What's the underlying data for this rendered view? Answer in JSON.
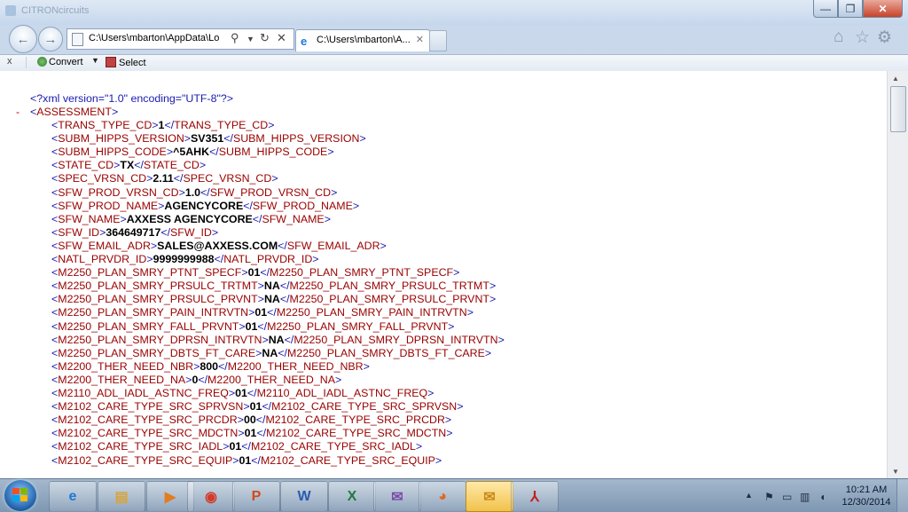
{
  "window": {
    "title": "CITRONcircuits",
    "buttons": {
      "minimize": "—",
      "maximize": "❐",
      "close": "✕"
    }
  },
  "nav": {
    "back": "←",
    "forward": "→",
    "address": "C:\\Users\\mbarton\\AppData\\Lo",
    "tab_title": "C:\\Users\\mbarton\\A...",
    "tab_close": "✕",
    "icons": [
      "page-icon",
      "search-icon",
      "dropdown-icon",
      "refresh-icon",
      "stop-icon",
      "home-icon",
      "favorites-star-icon",
      "tools-gear-icon"
    ]
  },
  "command_bar": {
    "close_label": "x",
    "convert_label": "Convert",
    "convert_dropdown": "▼",
    "select_label": "Select"
  },
  "xml": {
    "declaration": "<?xml version=\"1.0\" encoding=\"UTF-8\"?>",
    "collapse_marker": "-",
    "root": "ASSESSMENT",
    "elements": [
      {
        "tag": "TRANS_TYPE_CD",
        "value": "1"
      },
      {
        "tag": "SUBM_HIPPS_VERSION",
        "value": "SV351"
      },
      {
        "tag": "SUBM_HIPPS_CODE",
        "value": "^5AHK"
      },
      {
        "tag": "STATE_CD",
        "value": "TX"
      },
      {
        "tag": "SPEC_VRSN_CD",
        "value": "2.11"
      },
      {
        "tag": "SFW_PROD_VRSN_CD",
        "value": "1.0"
      },
      {
        "tag": "SFW_PROD_NAME",
        "value": "AGENCYCORE"
      },
      {
        "tag": "SFW_NAME",
        "value": "AXXESS AGENCYCORE"
      },
      {
        "tag": "SFW_ID",
        "value": "364649717"
      },
      {
        "tag": "SFW_EMAIL_ADR",
        "value": "SALES@AXXESS.COM"
      },
      {
        "tag": "NATL_PRVDR_ID",
        "value": "9999999988"
      },
      {
        "tag": "M2250_PLAN_SMRY_PTNT_SPECF",
        "value": "01"
      },
      {
        "tag": "M2250_PLAN_SMRY_PRSULC_TRTMT",
        "value": "NA"
      },
      {
        "tag": "M2250_PLAN_SMRY_PRSULC_PRVNT",
        "value": "NA"
      },
      {
        "tag": "M2250_PLAN_SMRY_PAIN_INTRVTN",
        "value": "01"
      },
      {
        "tag": "M2250_PLAN_SMRY_FALL_PRVNT",
        "value": "01"
      },
      {
        "tag": "M2250_PLAN_SMRY_DPRSN_INTRVTN",
        "value": "NA"
      },
      {
        "tag": "M2250_PLAN_SMRY_DBTS_FT_CARE",
        "value": "NA"
      },
      {
        "tag": "M2200_THER_NEED_NBR",
        "value": "800"
      },
      {
        "tag": "M2200_THER_NEED_NA",
        "value": "0"
      },
      {
        "tag": "M2110_ADL_IADL_ASTNC_FREQ",
        "value": "01"
      },
      {
        "tag": "M2102_CARE_TYPE_SRC_SPRVSN",
        "value": "01"
      },
      {
        "tag": "M2102_CARE_TYPE_SRC_PRCDR",
        "value": "00"
      },
      {
        "tag": "M2102_CARE_TYPE_SRC_MDCTN",
        "value": "01"
      },
      {
        "tag": "M2102_CARE_TYPE_SRC_IADL",
        "value": "01"
      },
      {
        "tag": "M2102_CARE_TYPE_SRC_EQUIP",
        "value": "01"
      }
    ]
  },
  "taskbar": {
    "start": "start-orb",
    "apps": [
      {
        "name": "internet-explorer-icon",
        "glyph": "e",
        "color": "#1d78d6"
      },
      {
        "name": "file-explorer-icon",
        "glyph": "▤",
        "color": "#d8a43a"
      },
      {
        "name": "media-player-icon",
        "glyph": "▶",
        "color": "#e37b1f"
      },
      {
        "name": "chrome-icon",
        "glyph": "◉",
        "color": "#d23a2a"
      },
      {
        "name": "powerpoint-icon",
        "glyph": "P",
        "color": "#d04a1c"
      },
      {
        "name": "word-icon",
        "glyph": "W",
        "color": "#2a5cae"
      },
      {
        "name": "excel-icon",
        "glyph": "X",
        "color": "#1f7a3a"
      },
      {
        "name": "communicator-icon",
        "glyph": "✉",
        "color": "#7a4aa8"
      },
      {
        "name": "firefox-icon",
        "glyph": "◕",
        "color": "#e3661c"
      },
      {
        "name": "outlook-active-icon",
        "glyph": "✉",
        "color": "#c8881a"
      },
      {
        "name": "pdf-reader-icon",
        "glyph": "⅄",
        "color": "#c21f1f"
      }
    ],
    "clock": {
      "time": "10:21 AM",
      "date": "12/30/2014"
    }
  }
}
